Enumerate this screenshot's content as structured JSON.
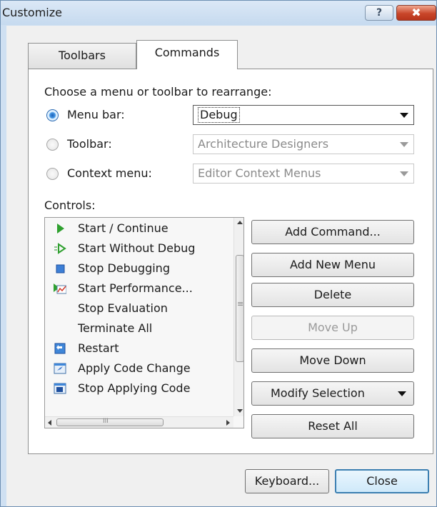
{
  "window": {
    "title": "Customize",
    "help_glyph": "?",
    "close_glyph": "✖"
  },
  "tabs": [
    {
      "label": "Toolbars",
      "selected": false
    },
    {
      "label": "Commands",
      "selected": true
    }
  ],
  "chooser": {
    "prompt": "Choose a menu or toolbar to rearrange:",
    "options": [
      {
        "label": "Menu bar:",
        "checked": true,
        "value": "Debug",
        "enabled": true
      },
      {
        "label": "Toolbar:",
        "checked": false,
        "value": "Architecture Designers",
        "enabled": false
      },
      {
        "label": "Context menu:",
        "checked": false,
        "value": "Editor Context Menus",
        "enabled": false
      }
    ]
  },
  "controls": {
    "label": "Controls:",
    "items": [
      {
        "text": "Start / Continue",
        "icon": "play-icon"
      },
      {
        "text": "Start Without Debug",
        "icon": "play-outline-icon"
      },
      {
        "text": "Stop Debugging",
        "icon": "stop-icon"
      },
      {
        "text": "Start Performance...",
        "icon": "performance-icon"
      },
      {
        "text": "Stop Evaluation",
        "icon": ""
      },
      {
        "text": "Terminate All",
        "icon": ""
      },
      {
        "text": "Restart",
        "icon": "restart-icon"
      },
      {
        "text": "Apply Code Change",
        "icon": "apply-code-icon"
      },
      {
        "text": "Stop Applying Code",
        "icon": "stop-applying-icon"
      }
    ],
    "hscroll_glyph": "III",
    "vscroll_glyph": "≡"
  },
  "buttons": {
    "add_command": "Add Command...",
    "add_new_menu": "Add New Menu",
    "delete": "Delete",
    "move_up": "Move Up",
    "move_down": "Move Down",
    "modify_selection": "Modify Selection",
    "reset_all": "Reset All"
  },
  "footer": {
    "keyboard": "Keyboard...",
    "close": "Close"
  }
}
